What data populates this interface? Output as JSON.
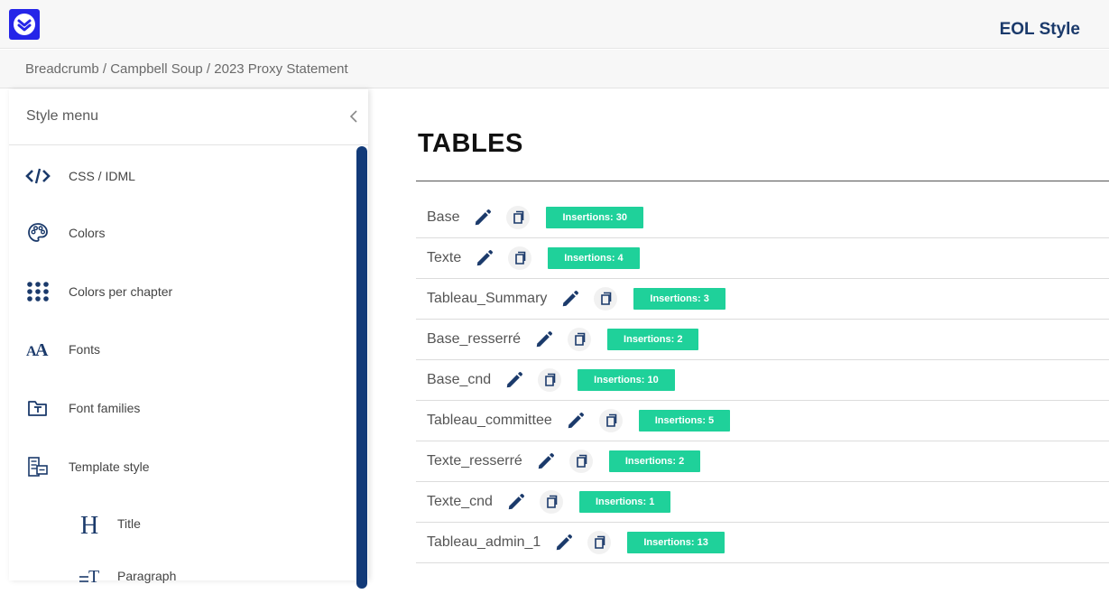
{
  "app": {
    "title": "EOL Style",
    "accent": "#2525e8",
    "brand_text_color": "#1b3a6b"
  },
  "breadcrumb": {
    "text": "Breadcrumb / Campbell Soup / 2023 Proxy Statement"
  },
  "sidebar": {
    "title": "Style menu",
    "collapse_icon": "chevron-left-icon",
    "items": [
      {
        "label": "CSS / IDML",
        "icon": "code-icon"
      },
      {
        "label": "Colors",
        "icon": "palette-icon"
      },
      {
        "label": "Colors per chapter",
        "icon": "dots-grid-icon"
      },
      {
        "label": "Fonts",
        "icon": "font-size-icon"
      },
      {
        "label": "Font families",
        "icon": "font-folder-icon"
      },
      {
        "label": "Template style",
        "icon": "template-icon"
      }
    ],
    "subitems": [
      {
        "label": "Title",
        "icon": "heading-icon"
      },
      {
        "label": "Paragraph",
        "icon": "paragraph-icon"
      }
    ]
  },
  "main": {
    "title": "TABLES",
    "badge_color": "#1fd19a",
    "rows": [
      {
        "name": "Base",
        "insertions": "Insertions: 30"
      },
      {
        "name": "Texte",
        "insertions": "Insertions: 4"
      },
      {
        "name": "Tableau_Summary",
        "insertions": "Insertions: 3"
      },
      {
        "name": "Base_resserré",
        "insertions": "Insertions: 2"
      },
      {
        "name": "Base_cnd",
        "insertions": "Insertions: 10"
      },
      {
        "name": "Tableau_committee",
        "insertions": "Insertions: 5"
      },
      {
        "name": "Texte_resserré",
        "insertions": "Insertions: 2"
      },
      {
        "name": "Texte_cnd",
        "insertions": "Insertions: 1"
      },
      {
        "name": "Tableau_admin_1",
        "insertions": "Insertions: 13"
      }
    ]
  }
}
